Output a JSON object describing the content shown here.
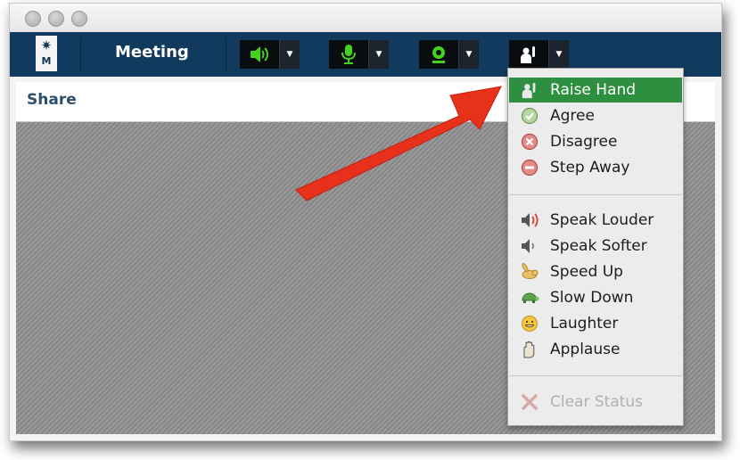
{
  "window": {
    "title_controls": [
      "close",
      "minimize",
      "zoom"
    ]
  },
  "toolbar": {
    "logo_letter": "M",
    "meeting_label": "Meeting",
    "buttons": [
      {
        "icon": "speaker-icon",
        "color": "#44d21e"
      },
      {
        "icon": "microphone-icon",
        "color": "#44d21e"
      },
      {
        "icon": "webcam-icon",
        "color": "#44d21e"
      },
      {
        "icon": "raise-hand-icon",
        "color": "#ffffff"
      }
    ]
  },
  "share": {
    "label": "Share"
  },
  "status_menu": {
    "items": [
      {
        "label": "Raise Hand",
        "icon": "raise-hand-icon",
        "active": true
      },
      {
        "label": "Agree",
        "icon": "check-circle-icon"
      },
      {
        "label": "Disagree",
        "icon": "x-circle-icon"
      },
      {
        "label": "Step Away",
        "icon": "minus-circle-icon"
      },
      {
        "label": "Speak Louder",
        "icon": "speaker-loud-icon"
      },
      {
        "label": "Speak Softer",
        "icon": "speaker-soft-icon"
      },
      {
        "label": "Speed Up",
        "icon": "rabbit-icon"
      },
      {
        "label": "Slow Down",
        "icon": "turtle-icon"
      },
      {
        "label": "Laughter",
        "icon": "smiley-icon"
      },
      {
        "label": "Applause",
        "icon": "applause-icon"
      }
    ],
    "clear_label": "Clear Status",
    "clear_icon": "x-mark-icon"
  },
  "colors": {
    "toolbar_bg": "#123a5e",
    "active_item": "#2f8f40",
    "annotation_arrow": "#e8311a"
  }
}
